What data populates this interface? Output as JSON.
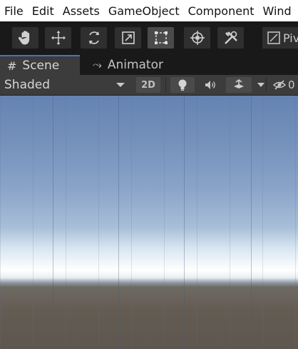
{
  "menu": {
    "items": [
      "File",
      "Edit",
      "Assets",
      "GameObject",
      "Component",
      "Wind"
    ]
  },
  "toolbar": {
    "tools": [
      {
        "icon": "hand-icon",
        "active": false
      },
      {
        "icon": "move-icon",
        "active": false
      },
      {
        "icon": "rotate-icon",
        "active": false
      },
      {
        "icon": "scale-icon",
        "active": false
      },
      {
        "icon": "rect-icon",
        "active": true
      },
      {
        "icon": "transform-icon",
        "active": false
      },
      {
        "icon": "custom-tool-icon",
        "active": false
      }
    ],
    "pivot_label": "Piv"
  },
  "tabs": {
    "scene_label": "Scene",
    "scene_glyph": "#",
    "animator_label": "Animator",
    "animator_glyph": "⤳"
  },
  "scenebar": {
    "draw_mode": "Shaded",
    "mode_2d_label": "2D",
    "hidden_label": "0"
  },
  "colors": {
    "accent": "#3a79bb",
    "toolbar_bg": "#191919",
    "active_tool_bg": "#4a4a4a"
  }
}
